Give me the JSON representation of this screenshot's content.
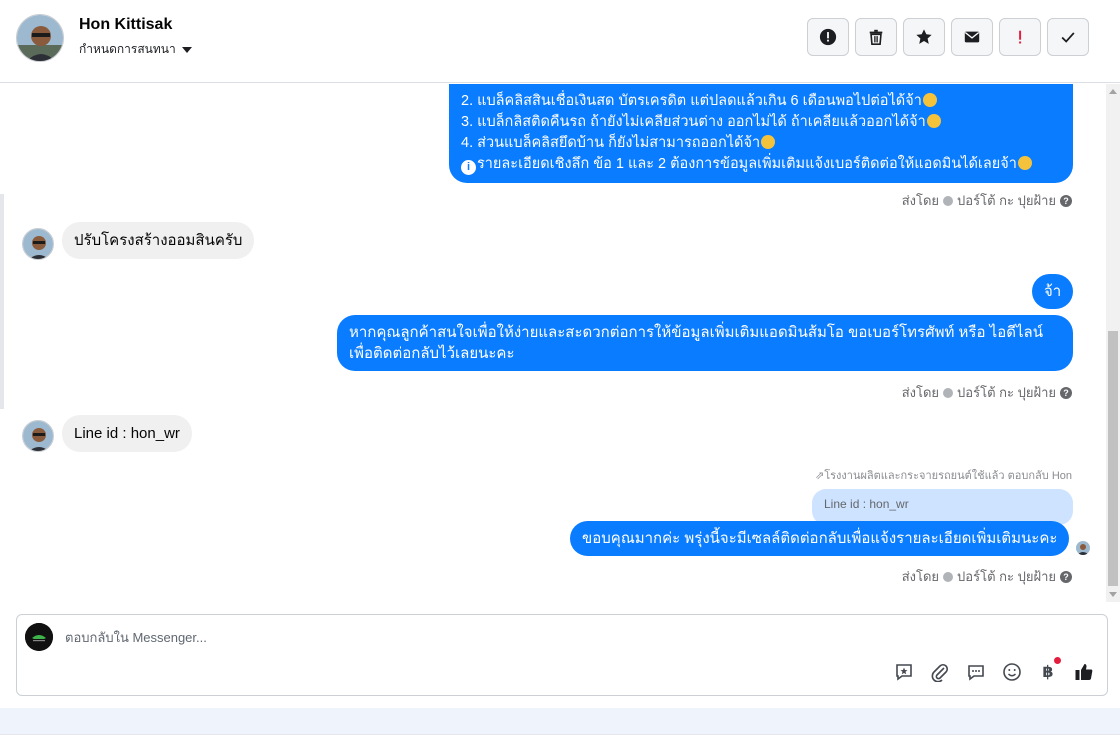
{
  "header": {
    "contact_name": "Hon Kittisak",
    "assign_label": "กำหนดการสนทนา",
    "actions": [
      {
        "icon": "exclamation-circle-icon"
      },
      {
        "icon": "trash-icon"
      },
      {
        "icon": "star-icon"
      },
      {
        "icon": "envelope-icon"
      },
      {
        "icon": "red-exclamation-icon"
      },
      {
        "icon": "checkmark-icon"
      }
    ]
  },
  "messages": {
    "top_list": {
      "line2": "2. แบล็คลิสสินเชื่อเงินสด บัตรเครดิต แต่ปลดแล้วเกิน 6 เดือนพอไปต่อได้จ้า",
      "line3": "3. แบล็กลิสติดคืนรถ ถ้ายังไม่เคลียส่วนต่าง ออกไม่ได้ ถ้าเคลียแล้วออกได้จ้า",
      "line4": "4. ส่วนแบล็คลิสยึดบ้าน ก็ยังไม่สามารถออกได้จ้า",
      "line5": "รายละเอียดเชิงลึก ข้อ 1 และ 2 ต้องการข้อมูลเพิ่มเติมแจ้งเบอร์ติดต่อให้แอดมินได้เลยจ้า"
    },
    "sent_by": "ส่งโดย",
    "sender": "ปอร์โต้ กะ ปุยฝ้าย",
    "incoming_1": "ปรับโครงสร้างออมสินครับ",
    "outgoing_short": "จ้า",
    "outgoing_long_1": "หากคุณลูกค้าสนใจเพื่อให้ง่ายและสะดวกต่อการให้ข้อมูลเพิ่มเติมแอดมินส้มโอ ขอเบอร์โทรศัพท์ หรือ ไอดีไลน์",
    "outgoing_long_2": "เพื่อติดต่อกลับไว้เลยนะคะ",
    "incoming_2": "Line id : hon_wr",
    "reply_meta": "โรงงานผลิตและกระจายรถยนต์ใช้แล้ว ตอบกลับ Hon",
    "quoted_text": "Line id : hon_wr",
    "outgoing_reply": "ขอบคุณมากค่ะ พรุ่งนี้จะมีเซลล์ติดต่อกลับเพื่อแจ้งรายละเอียดเพิ่มเติมนะคะ"
  },
  "composer": {
    "placeholder": "ตอบกลับใน Messenger...",
    "tools": [
      "saved-reply-icon",
      "attachment-icon",
      "chat-bubble-icon",
      "emoji-icon",
      "baht-payment-icon",
      "like-icon"
    ],
    "baht_symbol": "฿"
  },
  "colors": {
    "outgoing_bubble": "#0a7cff",
    "incoming_bubble": "#f0f0f0",
    "quote_bubble": "#cde3ff"
  }
}
